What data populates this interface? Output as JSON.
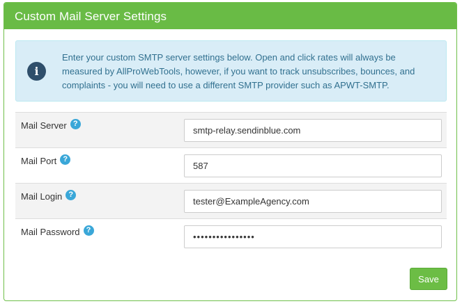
{
  "panel": {
    "title": "Custom Mail Server Settings"
  },
  "alert": {
    "icon": "info-icon",
    "icon_glyph": "i",
    "text": "Enter your custom SMTP server settings below. Open and click rates will always be measured by AllProWebTools, however, if you want to track unsubscribes, bounces, and complaints - you will need to use a different SMTP provider such as APWT-SMTP."
  },
  "fields": [
    {
      "label": "Mail Server",
      "value": "smtp-relay.sendinblue.com",
      "help_icon": "question-circle-icon",
      "help_glyph": "?"
    },
    {
      "label": "Mail Port",
      "value": "587",
      "help_icon": "question-circle-icon",
      "help_glyph": "?"
    },
    {
      "label": "Mail Login",
      "value": "tester@ExampleAgency.com",
      "help_icon": "question-circle-icon",
      "help_glyph": "?"
    },
    {
      "label": "Mail Password",
      "value": "••••••••••••••••",
      "help_icon": "question-circle-icon",
      "help_glyph": "?"
    }
  ],
  "actions": {
    "save_label": "Save"
  },
  "colors": {
    "header": "#69bb45",
    "alert_bg": "#d9edf7",
    "alert_text": "#31708f",
    "help_icon": "#3aa7d8",
    "save_button": "#6cbd45"
  }
}
